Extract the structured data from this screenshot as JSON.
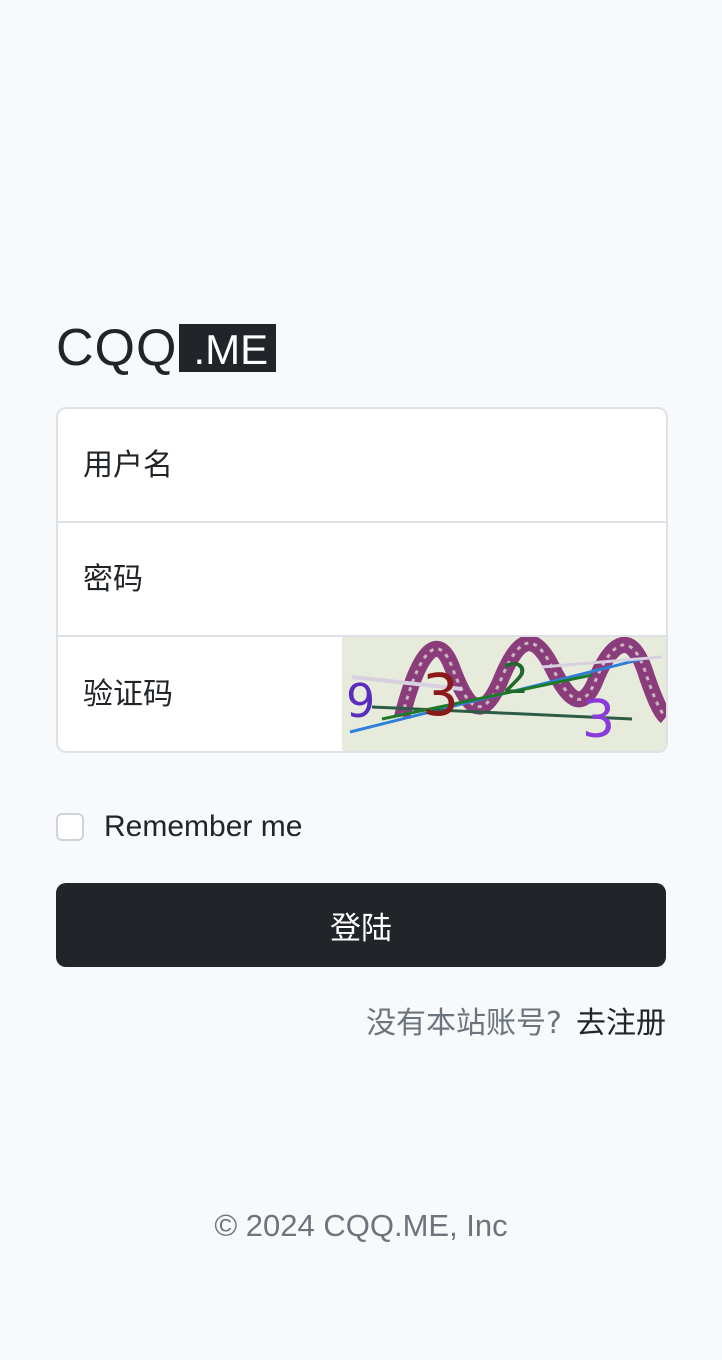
{
  "brand": {
    "main": "CQQ",
    "tag": ".ME"
  },
  "form": {
    "username_placeholder": "用户名",
    "password_placeholder": "密码",
    "captcha_placeholder": "验证码",
    "captcha_chars": [
      "9",
      "3",
      "2",
      "3"
    ]
  },
  "remember": {
    "label": "Remember me"
  },
  "login_button": {
    "label": "登陆"
  },
  "register": {
    "prompt": "没有本站账号?",
    "link_label": "去注册"
  },
  "footer": {
    "text": "© 2024 CQQ.ME, Inc"
  },
  "colors": {
    "background": "#f8f9fa",
    "primary": "#212529",
    "muted": "#6c757d",
    "border": "#dee2e6",
    "captcha_bg": "#e6ebdb"
  }
}
